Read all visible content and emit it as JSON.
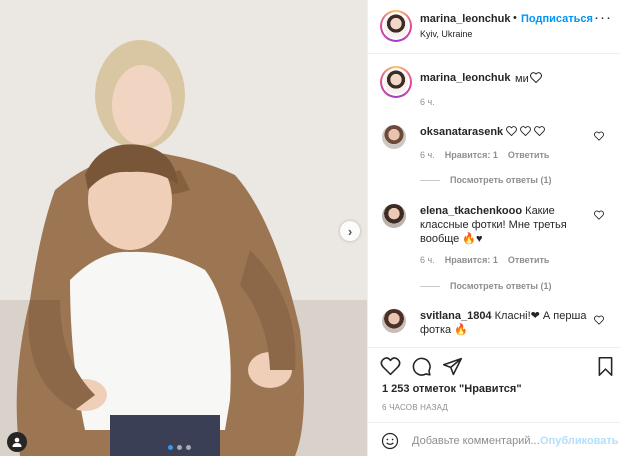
{
  "header": {
    "username": "marina_leonchuk",
    "separator": "•",
    "follow_label": "Подписаться",
    "location": "Kyiv, Ukraine",
    "more_label": "···"
  },
  "caption": {
    "username": "marina_leonchuk",
    "text": "ми",
    "time": "6 ч."
  },
  "comments": [
    {
      "username": "oksanatarasenk",
      "text": "",
      "time": "6 ч.",
      "likes": "Нравится: 1",
      "reply": "Ответить",
      "view_replies": "Посмотреть ответы (1)"
    },
    {
      "username": "elena_tkachenkooo",
      "text_line1": "Какие",
      "text_line2": "классные фотки! Мне третья",
      "text_line3": "вообще 🔥♥",
      "time": "6 ч.",
      "likes": "Нравится: 1",
      "reply": "Ответить",
      "view_replies": "Посмотреть ответы (1)"
    },
    {
      "username": "svitlana_1804",
      "text_line1": "Класні!❤ А перша",
      "text_line2": "фотка 🔥"
    }
  ],
  "actions": {
    "likes_count": "1 253 отметок \"Нравится\"",
    "time_ago": "6 ЧАСОВ НАЗАД",
    "comment_placeholder": "Добавьте комментарий...",
    "publish_label": "Опубликовать"
  },
  "carousel": {
    "slides": 3,
    "active": 0,
    "next_label": "›"
  },
  "colors": {
    "accent": "#0095f6",
    "publish_disabled": "#b2dffc",
    "muted": "#8e8e8e",
    "text": "#262626",
    "divider": "#efefef"
  },
  "icons": [
    "heart-icon",
    "comment-icon",
    "share-icon",
    "bookmark-icon",
    "emoji-icon",
    "user-tag-icon",
    "more-icon",
    "chevron-right-icon"
  ]
}
